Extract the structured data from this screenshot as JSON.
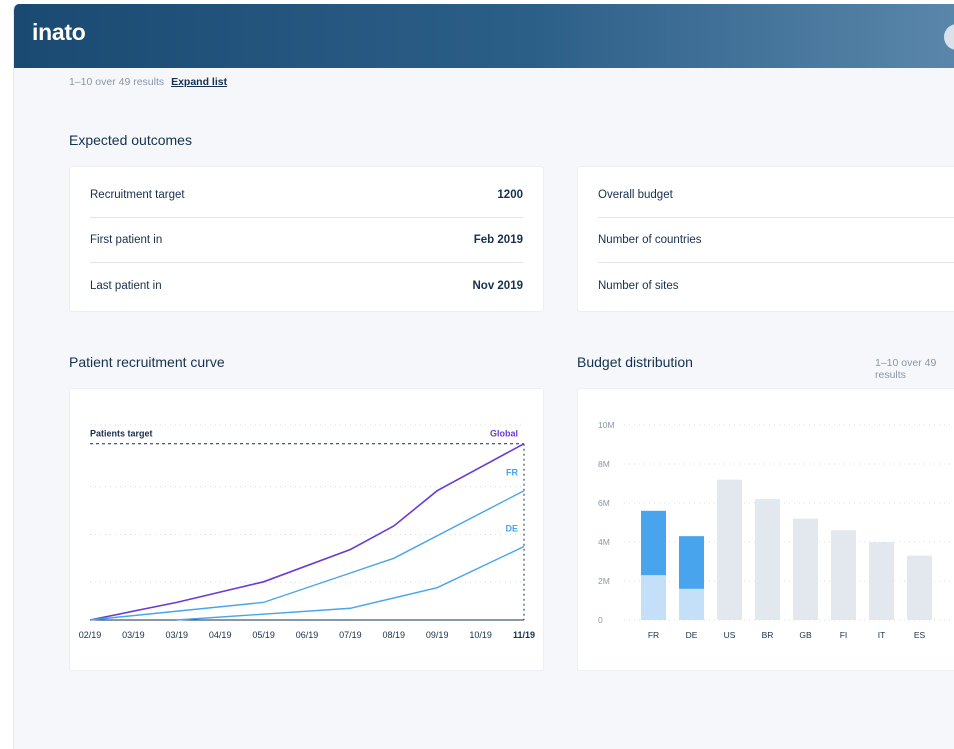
{
  "header": {
    "logo": "inato"
  },
  "results": {
    "text": "1–10 over 49 results",
    "expand_label": "Expand list"
  },
  "expected_outcomes": {
    "title": "Expected outcomes",
    "left_rows": [
      {
        "label": "Recruitment target",
        "value": "1200"
      },
      {
        "label": "First patient in",
        "value": "Feb 2019"
      },
      {
        "label": "Last patient in",
        "value": "Nov 2019"
      }
    ],
    "right_rows": [
      {
        "label": "Overall budget"
      },
      {
        "label": "Number of countries"
      },
      {
        "label": "Number of sites"
      }
    ]
  },
  "recruitment": {
    "title": "Patient recruitment curve",
    "target_label": "Patients target"
  },
  "budget": {
    "title": "Budget distribution",
    "results_text": "1–10 over 49 results"
  },
  "colors": {
    "global": "#6a3bd6",
    "country": "#48a4ec",
    "bar_dark": "#48a4ec",
    "bar_light": "#c4e0f8",
    "bar_gray": "#e3e8ee",
    "header_start": "#1a4a72"
  },
  "chart_data": [
    {
      "type": "line",
      "title": "",
      "x": [
        "02/19",
        "03/19",
        "03/19",
        "04/19",
        "05/19",
        "06/19",
        "07/19",
        "08/19",
        "09/19",
        "10/19",
        "11/19"
      ],
      "series": [
        {
          "name": "Global",
          "values": [
            0,
            null,
            120,
            null,
            260,
            null,
            480,
            640,
            880,
            null,
            1200
          ]
        },
        {
          "name": "FR",
          "values": [
            0,
            null,
            null,
            null,
            120,
            null,
            320,
            420,
            null,
            null,
            880
          ]
        },
        {
          "name": "DE",
          "values": [
            null,
            null,
            0,
            null,
            null,
            null,
            80,
            null,
            220,
            null,
            500
          ]
        }
      ],
      "target_line": 1200,
      "ylim": [
        0,
        1300
      ],
      "grid": true
    },
    {
      "type": "bar",
      "title": "",
      "categories": [
        "FR",
        "DE",
        "US",
        "BR",
        "GB",
        "FI",
        "IT",
        "ES"
      ],
      "series": [
        {
          "values": [
            2.3,
            1.6,
            0,
            0,
            0,
            0,
            0,
            0
          ]
        },
        {
          "values": [
            3.3,
            2.7,
            0,
            0,
            0,
            0,
            0,
            0
          ]
        },
        {
          "values": [
            0,
            0,
            7.2,
            6.2,
            5.2,
            4.6,
            4.0,
            3.3
          ]
        }
      ],
      "stacked": true,
      "ylim": [
        0,
        10
      ],
      "yticks": [
        "0",
        "2M",
        "4M",
        "6M",
        "8M",
        "10M"
      ],
      "grid": true
    }
  ]
}
